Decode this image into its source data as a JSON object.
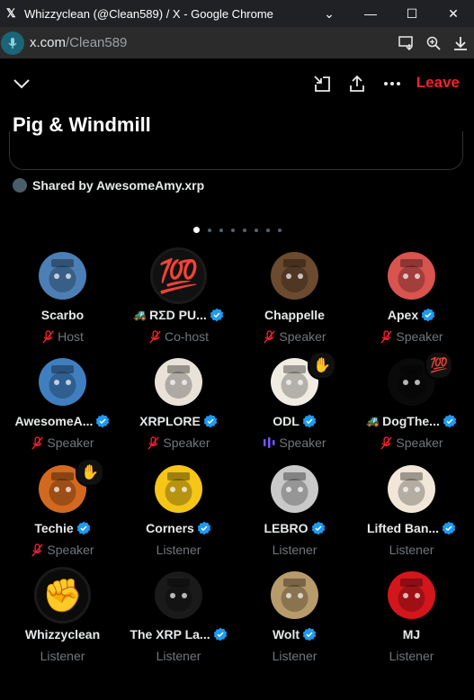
{
  "browser": {
    "window_title": "Whizzyclean (@Clean589) / X - Google Chrome",
    "url_host": "x.com",
    "url_path": "/Clean589"
  },
  "space": {
    "title": "Pig & Windmill",
    "leave_label": "Leave",
    "shared_by": "Shared by AwesomeAmy.xrp",
    "page_dots": 8,
    "active_dot": 0
  },
  "colors": {
    "accent_blue": "#1d9bf0",
    "leave_red": "#f4212e",
    "muted": "#71767b"
  },
  "participants": [
    {
      "name": "Scarbo",
      "role": "Host",
      "verified": false,
      "muted": true,
      "prefix": "",
      "avatar_color": "#4c7fb5"
    },
    {
      "name": "RΣD PU...",
      "role": "Co-host",
      "verified": true,
      "muted": true,
      "prefix": "🚜",
      "avatar_color": "#111111",
      "avatar_glyph": "💯"
    },
    {
      "name": "Chappelle",
      "role": "Speaker",
      "verified": false,
      "muted": true,
      "prefix": "",
      "avatar_color": "#6b4a2f"
    },
    {
      "name": "Apex",
      "role": "Speaker",
      "verified": true,
      "muted": true,
      "prefix": "",
      "avatar_color": "#d9534f"
    },
    {
      "name": "AwesomeA...",
      "role": "Speaker",
      "verified": true,
      "muted": true,
      "prefix": "",
      "avatar_color": "#3f7fbf"
    },
    {
      "name": "XRPLORE",
      "role": "Speaker",
      "verified": true,
      "muted": true,
      "prefix": "",
      "avatar_color": "#e8e2d8"
    },
    {
      "name": "ODL",
      "role": "Speaker",
      "verified": true,
      "muted": false,
      "speaking": true,
      "prefix": "",
      "avatar_color": "#f1ece3",
      "hand": "✋"
    },
    {
      "name": "DogThe...",
      "role": "Speaker",
      "verified": true,
      "muted": true,
      "prefix": "🚜",
      "avatar_color": "#0a0a0a",
      "hand": "💯"
    },
    {
      "name": "Techie",
      "role": "Speaker",
      "verified": true,
      "muted": true,
      "prefix": "",
      "avatar_color": "#d2691e",
      "hand": "✋"
    },
    {
      "name": "Corners",
      "role": "Listener",
      "verified": true,
      "muted": false,
      "prefix": "",
      "avatar_color": "#f5c518"
    },
    {
      "name": "LEBRO",
      "role": "Listener",
      "verified": true,
      "muted": false,
      "prefix": "",
      "avatar_color": "#c9c9c9"
    },
    {
      "name": "Lifted Ban...",
      "role": "Listener",
      "verified": true,
      "muted": false,
      "prefix": "",
      "avatar_color": "#f2e6d8"
    },
    {
      "name": "Whizzyclean",
      "role": "Listener",
      "verified": false,
      "muted": false,
      "prefix": "",
      "avatar_color": "#0b0b0b",
      "avatar_glyph": "✊"
    },
    {
      "name": "The XRP La...",
      "role": "Listener",
      "verified": true,
      "muted": false,
      "prefix": "",
      "avatar_color": "#1a1a1a"
    },
    {
      "name": "Wolt",
      "role": "Listener",
      "verified": true,
      "muted": false,
      "prefix": "",
      "avatar_color": "#b89b6b"
    },
    {
      "name": "MJ",
      "role": "Listener",
      "verified": false,
      "muted": false,
      "prefix": "",
      "avatar_color": "#d4161c"
    }
  ]
}
